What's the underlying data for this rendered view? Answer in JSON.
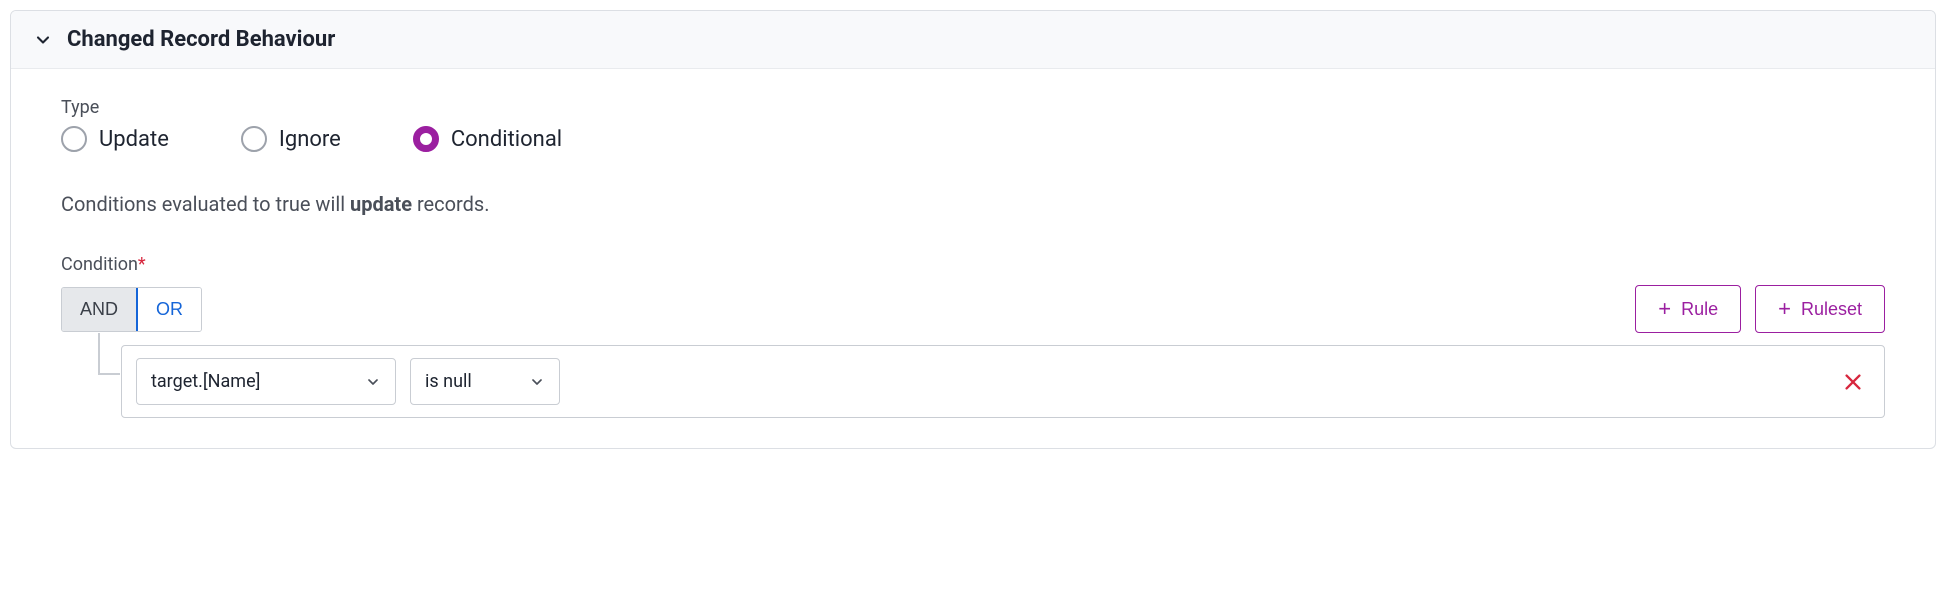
{
  "panel": {
    "title": "Changed Record Behaviour"
  },
  "type": {
    "label": "Type",
    "options": [
      {
        "label": "Update",
        "selected": false
      },
      {
        "label": "Ignore",
        "selected": false
      },
      {
        "label": "Conditional",
        "selected": true
      }
    ]
  },
  "help": {
    "prefix": "Conditions evaluated to true will ",
    "bold": "update",
    "suffix": " records."
  },
  "condition": {
    "label": "Condition",
    "required": "*",
    "logic": {
      "and": "AND",
      "or": "OR",
      "active": "and"
    },
    "buttons": {
      "rule": "Rule",
      "ruleset": "Ruleset"
    },
    "rule": {
      "field": "target.[Name]",
      "operator": "is null"
    }
  },
  "colors": {
    "accent": "#9b1fa0",
    "link": "#1565d8",
    "danger": "#d7263d"
  }
}
